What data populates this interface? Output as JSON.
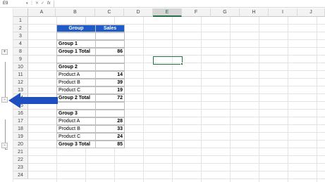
{
  "formula_bar": {
    "name_box": "E9",
    "name_box_arrow": "▾",
    "menu_icon": "⋮",
    "cancel": "✕",
    "enter": "✓",
    "fx": "fx",
    "formula": ""
  },
  "columns": [
    "A",
    "B",
    "C",
    "D",
    "E",
    "F",
    "G",
    "H",
    "I",
    "J"
  ],
  "selected_column": "E",
  "rows": [
    "1",
    "2",
    "3",
    "4",
    "8",
    "9",
    "10",
    "11",
    "12",
    "13",
    "14",
    "15",
    "16",
    "17",
    "18",
    "19",
    "20",
    "21",
    "22",
    "23",
    "24"
  ],
  "outline": {
    "collapse_sign": "-",
    "expand_sign": "+",
    "arrow_color": "#1f4fbf"
  },
  "table": {
    "header": {
      "group": "Group",
      "sales": "Sales"
    },
    "rows": [
      {
        "label": "",
        "value": ""
      },
      {
        "label": "Group 1",
        "value": "",
        "bold": true
      },
      {
        "label": "Group 1 Total",
        "value": "86",
        "bold": true
      },
      {
        "label": "",
        "value": ""
      },
      {
        "label": "Group 2",
        "value": "",
        "bold": true
      },
      {
        "label": "Product A",
        "value": "14"
      },
      {
        "label": "Product B",
        "value": "39"
      },
      {
        "label": "Product C",
        "value": "19"
      },
      {
        "label": "Group 2 Total",
        "value": "72",
        "bold": true
      },
      {
        "label": "",
        "value": ""
      },
      {
        "label": "Group 3",
        "value": "",
        "bold": true
      },
      {
        "label": "Product A",
        "value": "28"
      },
      {
        "label": "Product B",
        "value": "33"
      },
      {
        "label": "Product C",
        "value": "24"
      },
      {
        "label": "Group 3 Total",
        "value": "85",
        "bold": true
      }
    ]
  },
  "colors": {
    "header_fill": "#1e5bc6",
    "selection": "#217346"
  }
}
